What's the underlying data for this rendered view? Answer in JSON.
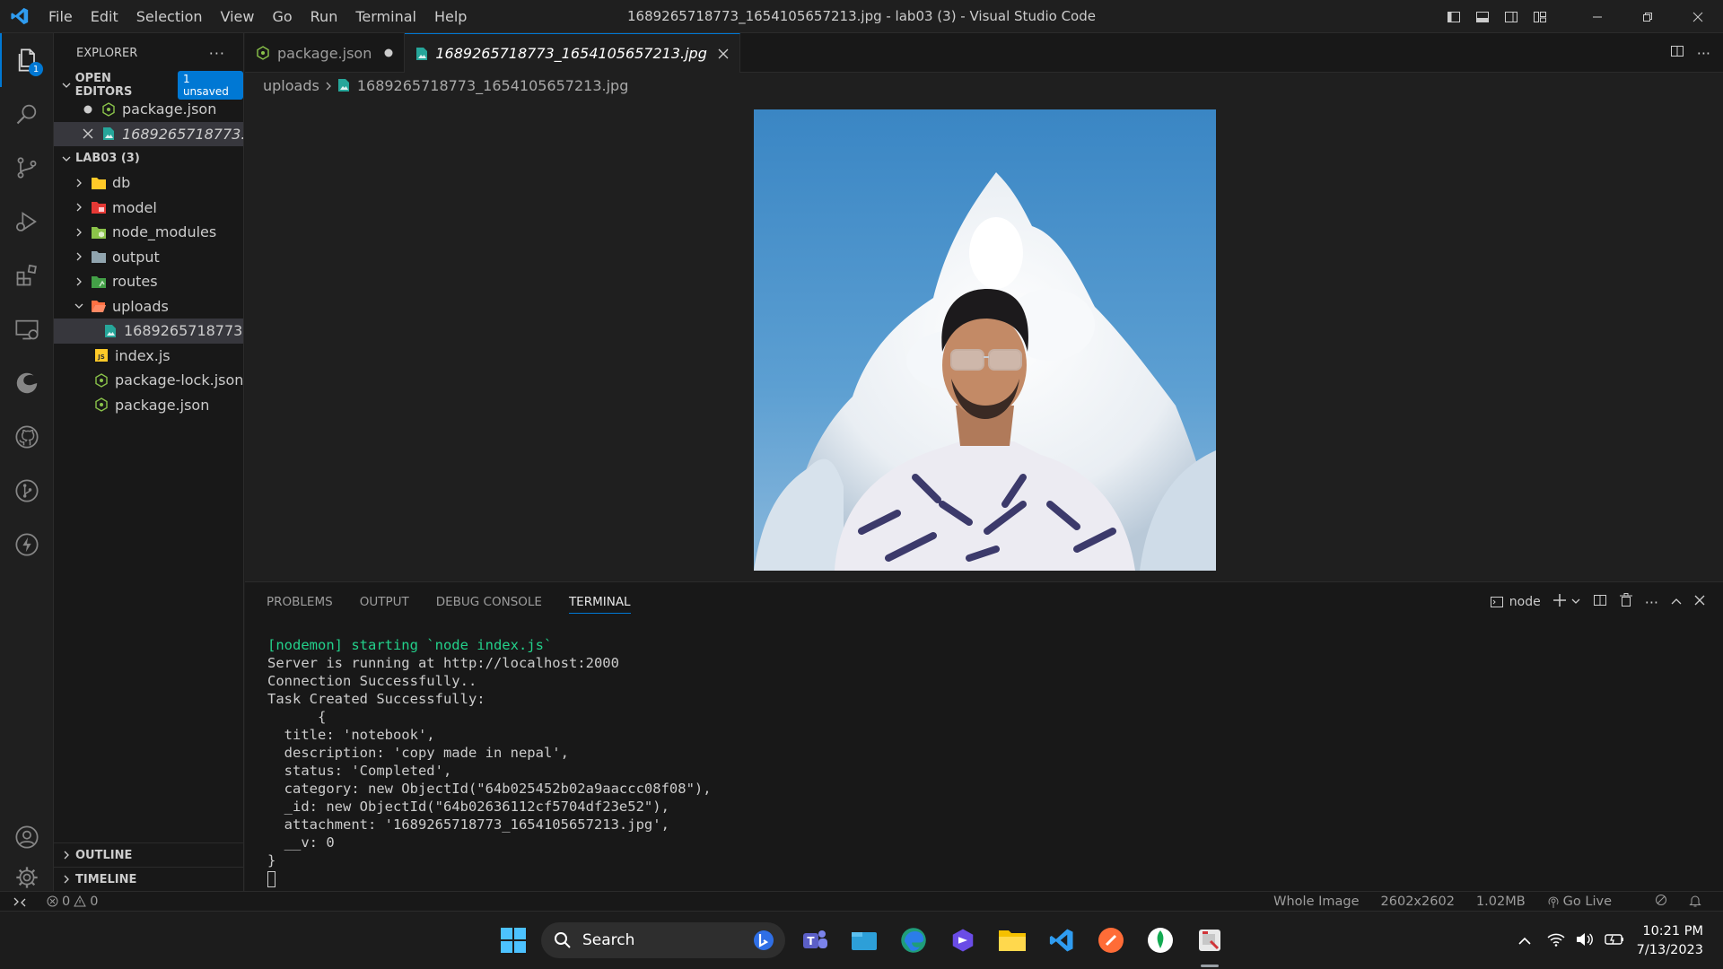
{
  "titlebar": {
    "menu": [
      "File",
      "Edit",
      "Selection",
      "View",
      "Go",
      "Run",
      "Terminal",
      "Help"
    ],
    "title": "1689265718773_1654105657213.jpg - lab03 (3) - Visual Studio Code"
  },
  "activity_bar": {
    "explorer_badge": "1"
  },
  "sidebar": {
    "title": "EXPLORER",
    "open_editors": {
      "label": "OPEN EDITORS",
      "badge": "1 unsaved",
      "items": [
        "package.json",
        "1689265718773..."
      ]
    },
    "project": {
      "label": "LAB03 (3)",
      "folders": [
        "db",
        "model",
        "node_modules",
        "output",
        "routes",
        "uploads"
      ],
      "uploads_child": "1689265718773...",
      "files": [
        "index.js",
        "package-lock.json",
        "package.json"
      ]
    },
    "outline": "OUTLINE",
    "timeline": "TIMELINE"
  },
  "tabs": [
    {
      "label": "package.json"
    },
    {
      "label": "1689265718773_1654105657213.jpg"
    }
  ],
  "breadcrumb": {
    "folder": "uploads",
    "file": "1689265718773_1654105657213.jpg"
  },
  "panel": {
    "tabs": [
      "PROBLEMS",
      "OUTPUT",
      "DEBUG CONSOLE",
      "TERMINAL"
    ],
    "terminal_name": "node",
    "lines": [
      "[nodemon] starting `node index.js`",
      "Server is running at http://localhost:2000",
      "Connection Successfully..",
      "Task Created Successfully:",
      "      {",
      "  title: 'notebook',",
      "  description: 'copy made in nepal',",
      "  status: 'Completed',",
      "  category: new ObjectId(\"64b025452b02a9aaccc08f08\"),",
      "  _id: new ObjectId(\"64b02636112cf5704df23e52\"),",
      "  attachment: '1689265718773_1654105657213.jpg',",
      "  __v: 0",
      "}"
    ]
  },
  "statusbar": {
    "errors": "0",
    "warnings": "0",
    "image_scope": "Whole Image",
    "dimensions": "2602x2602",
    "size": "1.02MB",
    "go_live": "Go Live"
  },
  "taskbar": {
    "search": "Search",
    "time": "10:21 PM",
    "date": "7/13/2023"
  },
  "colors": {
    "accent": "#0078d4",
    "terminal_green": "#23d18b"
  }
}
